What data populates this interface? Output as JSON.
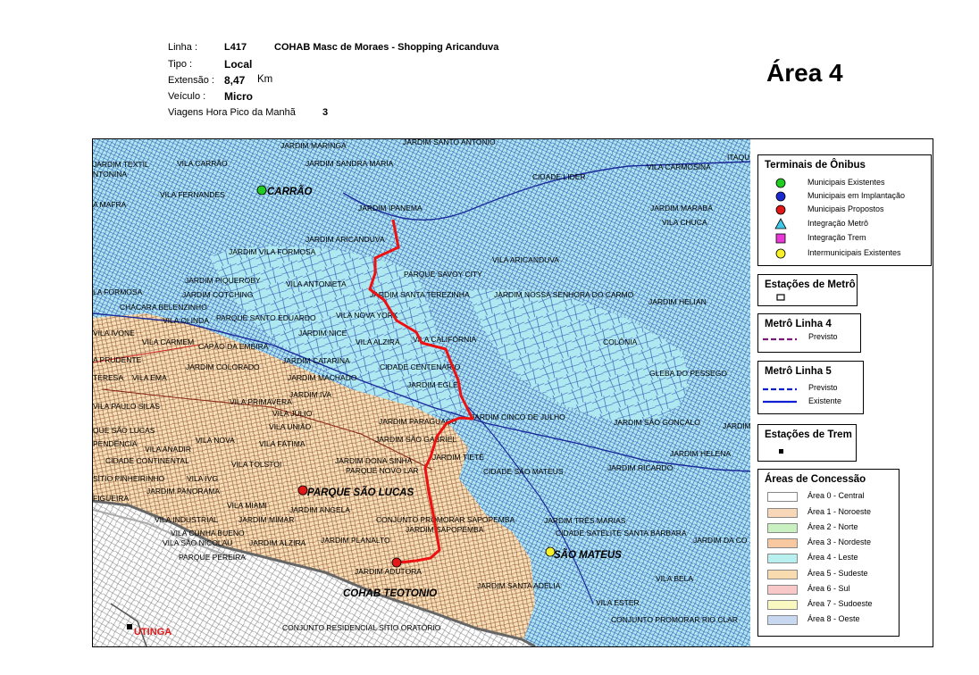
{
  "header": {
    "linha_label": "Linha :",
    "linha_code": "L417",
    "linha_name": "COHAB Masc de Moraes - Shopping Aricanduva",
    "tipo_label": "Tipo :",
    "tipo_value": "Local",
    "extensao_label": "Extensão :",
    "extensao_value": "8,47",
    "extensao_unit": "Km",
    "veiculo_label": "Veículo :",
    "veiculo_value": "Micro",
    "viagens_label": "Viagens Hora Pico da Manhã",
    "viagens_value": "3"
  },
  "area_title": "Área  4",
  "colors": {
    "route": "#ee1111",
    "area4_leste": "#aee8f0",
    "area5_sudeste": "#f7dfb8",
    "area0_central": "#ffffff",
    "street_leste": "#1a3aa8",
    "street_sudeste": "#8a4b2a",
    "metro_line": "#1020d0",
    "metro4": "#7a1a7a"
  },
  "map": {
    "places": [
      "JARDIM MARINGÁ",
      "JARDIM SANTO ANTONIO",
      "ITAQUER",
      "JARDIM TEXTIL",
      "VILA CARRÃO",
      "JARDIM SANDRA MARIA",
      "VILA CARMOSINA",
      "NTONINA",
      "CIDADE LIDER",
      "VILA FERNANDES",
      "A MAFRA",
      "JARDIM IPANEMA",
      "JARDIM MARABÁ",
      "VILA CHUCA",
      "JARDIM ARICANDUVA",
      "JARDIM VILA FORMOSA",
      "VILA ARICANDUVA",
      "PARQUE SAVOY CITY",
      "JARDIM PIQUEROBY",
      "VILA ANTONIETA",
      "LA FORMOSA",
      "JARDIM COTCHING",
      "JARDIM SANTA TEREZINHA",
      "JARDIM NOSSA SENHORA DO CARMO",
      "JARDIM HELIAN",
      "CHÁCARA BELENZINHO",
      "VILA NOVA YORK",
      "VILA OLINDA",
      "PARQUE SANTO EDUARDO",
      "VILA IVONE",
      "JARDIM NICE",
      "VILA CARMEM",
      "CAPÃO DA EMBIRA",
      "VILA ALZIRA",
      "VILA CALIFÓRNIA",
      "COLÔNIA",
      "A PRUDENTE",
      "JARDIM COLORADO",
      "JARDIM CATARINA",
      "CIDADE CENTENÁRIO",
      "GLEBA DO PESSEGO",
      "TERESA",
      "VILA EMA",
      "JARDIM MACHADO",
      "JARDIM EGLE",
      "JARDIM IVA",
      "VILA PAULO SILAS",
      "VILA PRIMAVERA",
      "VILA JÚLIO",
      "JARDIM PARAGUAÇU",
      "JARDIM CINCO DE JULHO",
      "JARDIM SÃO GONÇALO",
      "JARDIM D",
      "QUE SÃO LUCAS",
      "VILA UNIÃO",
      "PENDÊNCIA",
      "VILA NOVA",
      "VILA FÁTIMA",
      "JARDIM SÃO GABRIEL",
      "VILA ANADIR",
      "JARDIM HELENA",
      "CIDADE CONTINENTAL",
      "VILA TOLSTOI",
      "JARDIM DONA SINHÁ",
      "JARDIM TIETÊ",
      "JARDIM RICARDO",
      "PARQUE NOVO LAR",
      "CIDADE SÃO MATEUS",
      "SÍTIO PINHEIRINHO",
      "VILA IVG",
      "JARDIM PANORAMA",
      "FIGUEIRA",
      "VILA MIAMI",
      "JARDIM ANGELA",
      "CONJUNTO PROMORAR SAPOPEMBA",
      "JARDIM TRÊS MARIAS",
      "VILA INDUSTRIAL",
      "JARDIM MIMAR",
      "CIDADE SATÉLITE SANTA BÁRBARA",
      "VILA CUNHA BUENO",
      "JARDIM SAPOPEMBA",
      "JARDIM DA CO",
      "VILA SÃO NICOLAU",
      "JARDIM ALZIRA",
      "JARDIM PLANALTO",
      "PARQUE PEREIRA",
      "JARDIM ADUTORA",
      "VILA BELA",
      "JARDIM SANTA ADÉLIA",
      "VILA ESTER",
      "CONJUNTO PROMORAR RIO CLAR",
      "CONJUNTO RESIDENCIAL SÍTIO ORATÓRIO"
    ],
    "terminals": {
      "carrao": "CARRÃO",
      "parque_sao_lucas": "PARQUE SÃO LUCAS",
      "cohab_teotonio": "COHAB TEOTONIO",
      "sao_mateus": "SÃO MATEUS",
      "utinga": "UTINGA"
    }
  },
  "legend": {
    "terminais": {
      "title": "Terminais de Ônibus",
      "items": [
        {
          "label": "Municipais Existentes",
          "color": "#22cc22",
          "shape": "circle"
        },
        {
          "label": "Municipais em Implantação",
          "color": "#1a2ad0",
          "shape": "circle"
        },
        {
          "label": "Municipais Propostos",
          "color": "#e01818",
          "shape": "circle"
        },
        {
          "label": "Integração Metrô",
          "color": "#40c8e8",
          "shape": "triangle"
        },
        {
          "label": "Integração Trem",
          "color": "#e838d8",
          "shape": "square"
        },
        {
          "label": "Intermunicipais Existentes",
          "color": "#f8f028",
          "shape": "circle"
        }
      ]
    },
    "estacoes_metro": {
      "title": "Estações de Metrô"
    },
    "metro4": {
      "title": "Metrô Linha 4",
      "items": [
        "Previsto"
      ]
    },
    "metro5": {
      "title": "Metrô Linha 5",
      "items": [
        "Previsto",
        "Existente"
      ]
    },
    "estacoes_trem": {
      "title": "Estações de Trem"
    },
    "concessao": {
      "title": "Áreas de Concessão",
      "items": [
        {
          "label": "Área 0 - Central",
          "color": "#ffffff"
        },
        {
          "label": "Área 1 - Noroeste",
          "color": "#f8d6b8"
        },
        {
          "label": "Área 2 - Norte",
          "color": "#c8f0c0"
        },
        {
          "label": "Área 3 - Nordeste",
          "color": "#f8c8a0"
        },
        {
          "label": "Área 4 - Leste",
          "color": "#b8f0f0"
        },
        {
          "label": "Área 5 - Sudeste",
          "color": "#f8dcb0"
        },
        {
          "label": "Área 6 - Sul",
          "color": "#f8c8c8"
        },
        {
          "label": "Área 7 - Sudoeste",
          "color": "#f8f8c0"
        },
        {
          "label": "Área 8 - Oeste",
          "color": "#c8d8f0"
        }
      ]
    }
  }
}
